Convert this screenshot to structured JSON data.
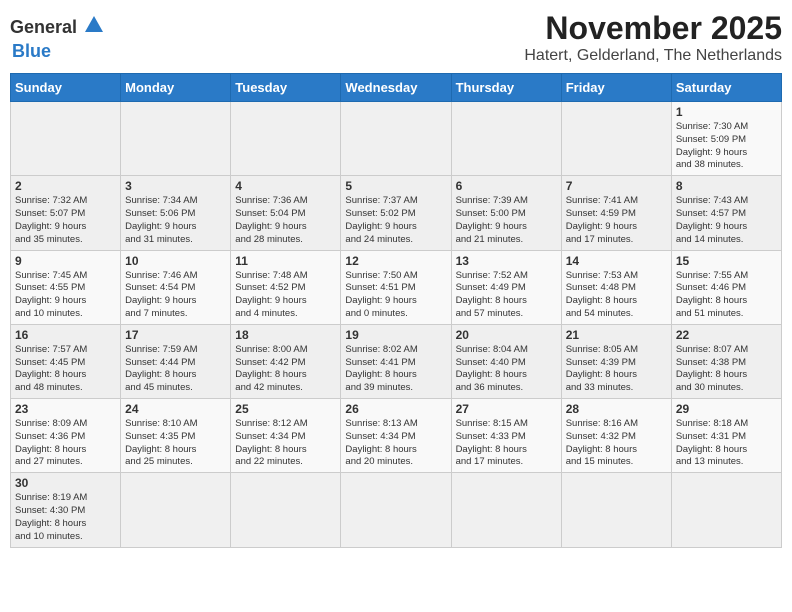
{
  "logo": {
    "line1": "General",
    "line2": "Blue"
  },
  "title": "November 2025",
  "subtitle": "Hatert, Gelderland, The Netherlands",
  "weekdays": [
    "Sunday",
    "Monday",
    "Tuesday",
    "Wednesday",
    "Thursday",
    "Friday",
    "Saturday"
  ],
  "weeks": [
    [
      {
        "day": "",
        "info": ""
      },
      {
        "day": "",
        "info": ""
      },
      {
        "day": "",
        "info": ""
      },
      {
        "day": "",
        "info": ""
      },
      {
        "day": "",
        "info": ""
      },
      {
        "day": "",
        "info": ""
      },
      {
        "day": "1",
        "info": "Sunrise: 7:30 AM\nSunset: 5:09 PM\nDaylight: 9 hours\nand 38 minutes."
      }
    ],
    [
      {
        "day": "2",
        "info": "Sunrise: 7:32 AM\nSunset: 5:07 PM\nDaylight: 9 hours\nand 35 minutes."
      },
      {
        "day": "3",
        "info": "Sunrise: 7:34 AM\nSunset: 5:06 PM\nDaylight: 9 hours\nand 31 minutes."
      },
      {
        "day": "4",
        "info": "Sunrise: 7:36 AM\nSunset: 5:04 PM\nDaylight: 9 hours\nand 28 minutes."
      },
      {
        "day": "5",
        "info": "Sunrise: 7:37 AM\nSunset: 5:02 PM\nDaylight: 9 hours\nand 24 minutes."
      },
      {
        "day": "6",
        "info": "Sunrise: 7:39 AM\nSunset: 5:00 PM\nDaylight: 9 hours\nand 21 minutes."
      },
      {
        "day": "7",
        "info": "Sunrise: 7:41 AM\nSunset: 4:59 PM\nDaylight: 9 hours\nand 17 minutes."
      },
      {
        "day": "8",
        "info": "Sunrise: 7:43 AM\nSunset: 4:57 PM\nDaylight: 9 hours\nand 14 minutes."
      }
    ],
    [
      {
        "day": "9",
        "info": "Sunrise: 7:45 AM\nSunset: 4:55 PM\nDaylight: 9 hours\nand 10 minutes."
      },
      {
        "day": "10",
        "info": "Sunrise: 7:46 AM\nSunset: 4:54 PM\nDaylight: 9 hours\nand 7 minutes."
      },
      {
        "day": "11",
        "info": "Sunrise: 7:48 AM\nSunset: 4:52 PM\nDaylight: 9 hours\nand 4 minutes."
      },
      {
        "day": "12",
        "info": "Sunrise: 7:50 AM\nSunset: 4:51 PM\nDaylight: 9 hours\nand 0 minutes."
      },
      {
        "day": "13",
        "info": "Sunrise: 7:52 AM\nSunset: 4:49 PM\nDaylight: 8 hours\nand 57 minutes."
      },
      {
        "day": "14",
        "info": "Sunrise: 7:53 AM\nSunset: 4:48 PM\nDaylight: 8 hours\nand 54 minutes."
      },
      {
        "day": "15",
        "info": "Sunrise: 7:55 AM\nSunset: 4:46 PM\nDaylight: 8 hours\nand 51 minutes."
      }
    ],
    [
      {
        "day": "16",
        "info": "Sunrise: 7:57 AM\nSunset: 4:45 PM\nDaylight: 8 hours\nand 48 minutes."
      },
      {
        "day": "17",
        "info": "Sunrise: 7:59 AM\nSunset: 4:44 PM\nDaylight: 8 hours\nand 45 minutes."
      },
      {
        "day": "18",
        "info": "Sunrise: 8:00 AM\nSunset: 4:42 PM\nDaylight: 8 hours\nand 42 minutes."
      },
      {
        "day": "19",
        "info": "Sunrise: 8:02 AM\nSunset: 4:41 PM\nDaylight: 8 hours\nand 39 minutes."
      },
      {
        "day": "20",
        "info": "Sunrise: 8:04 AM\nSunset: 4:40 PM\nDaylight: 8 hours\nand 36 minutes."
      },
      {
        "day": "21",
        "info": "Sunrise: 8:05 AM\nSunset: 4:39 PM\nDaylight: 8 hours\nand 33 minutes."
      },
      {
        "day": "22",
        "info": "Sunrise: 8:07 AM\nSunset: 4:38 PM\nDaylight: 8 hours\nand 30 minutes."
      }
    ],
    [
      {
        "day": "23",
        "info": "Sunrise: 8:09 AM\nSunset: 4:36 PM\nDaylight: 8 hours\nand 27 minutes."
      },
      {
        "day": "24",
        "info": "Sunrise: 8:10 AM\nSunset: 4:35 PM\nDaylight: 8 hours\nand 25 minutes."
      },
      {
        "day": "25",
        "info": "Sunrise: 8:12 AM\nSunset: 4:34 PM\nDaylight: 8 hours\nand 22 minutes."
      },
      {
        "day": "26",
        "info": "Sunrise: 8:13 AM\nSunset: 4:34 PM\nDaylight: 8 hours\nand 20 minutes."
      },
      {
        "day": "27",
        "info": "Sunrise: 8:15 AM\nSunset: 4:33 PM\nDaylight: 8 hours\nand 17 minutes."
      },
      {
        "day": "28",
        "info": "Sunrise: 8:16 AM\nSunset: 4:32 PM\nDaylight: 8 hours\nand 15 minutes."
      },
      {
        "day": "29",
        "info": "Sunrise: 8:18 AM\nSunset: 4:31 PM\nDaylight: 8 hours\nand 13 minutes."
      }
    ],
    [
      {
        "day": "30",
        "info": "Sunrise: 8:19 AM\nSunset: 4:30 PM\nDaylight: 8 hours\nand 10 minutes."
      },
      {
        "day": "",
        "info": ""
      },
      {
        "day": "",
        "info": ""
      },
      {
        "day": "",
        "info": ""
      },
      {
        "day": "",
        "info": ""
      },
      {
        "day": "",
        "info": ""
      },
      {
        "day": "",
        "info": ""
      }
    ]
  ]
}
